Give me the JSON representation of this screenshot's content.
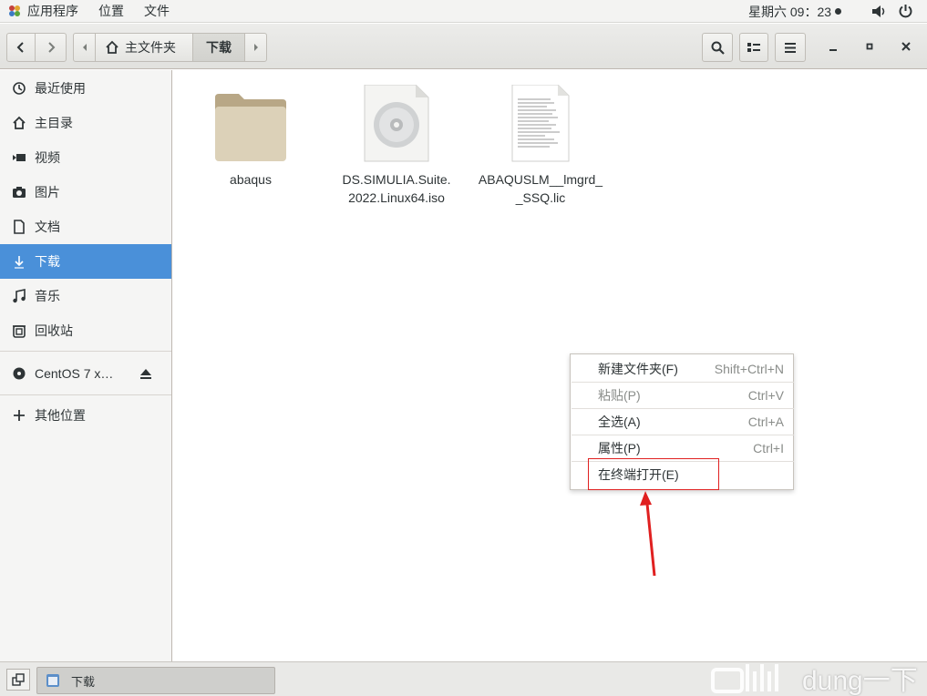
{
  "top_panel": {
    "apps_label": "应用程序",
    "places_label": "位置",
    "file_label": "文件",
    "clock": "星期六 09：23"
  },
  "headerbar": {
    "path_home_label": "主文件夹",
    "path_current_label": "下载"
  },
  "sidebar": {
    "items": [
      {
        "label": "最近使用",
        "icon": "clock-icon"
      },
      {
        "label": "主目录",
        "icon": "home-icon"
      },
      {
        "label": "视频",
        "icon": "video-icon"
      },
      {
        "label": "图片",
        "icon": "camera-icon"
      },
      {
        "label": "文档",
        "icon": "document-icon"
      },
      {
        "label": "下载",
        "icon": "download-icon",
        "active": true
      },
      {
        "label": "音乐",
        "icon": "music-icon"
      },
      {
        "label": "回收站",
        "icon": "trash-icon"
      },
      {
        "label": "CentOS 7 x…",
        "icon": "disc-icon"
      },
      {
        "label": "其他位置",
        "icon": "plus-icon"
      }
    ]
  },
  "files": [
    {
      "name": "abaqus",
      "icon": "folder-icon"
    },
    {
      "name": "DS.SIMULIA.Suite.2022.Linux64.iso",
      "line1": "DS.SIMULIA.Suite.",
      "line2": "2022.Linux64.iso",
      "icon": "disc-image-icon"
    },
    {
      "name": "ABAQUSLM__lmgrd__SSQ.lic",
      "line1": "ABAQUSLM__lmgrd_",
      "line2": "_SSQ.lic",
      "icon": "text-file-icon"
    }
  ],
  "context_menu": {
    "items": [
      {
        "label": "新建文件夹(F)",
        "accel": "Shift+Ctrl+N",
        "enabled": true
      },
      {
        "label": "粘贴(P)",
        "accel": "Ctrl+V",
        "enabled": false
      },
      {
        "label": "全选(A)",
        "accel": "Ctrl+A",
        "enabled": true
      },
      {
        "label": "属性(P)",
        "accel": "Ctrl+I",
        "enabled": true
      },
      {
        "label": "在终端打开(E)",
        "accel": "",
        "enabled": true
      }
    ]
  },
  "annotation": {
    "highlight_color": "#e02020"
  },
  "taskbar": {
    "window_label": "下载"
  },
  "watermark": {
    "text": "dung一下"
  },
  "colors": {
    "accent": "#4a90d9",
    "folder": "#d9cfb7"
  }
}
